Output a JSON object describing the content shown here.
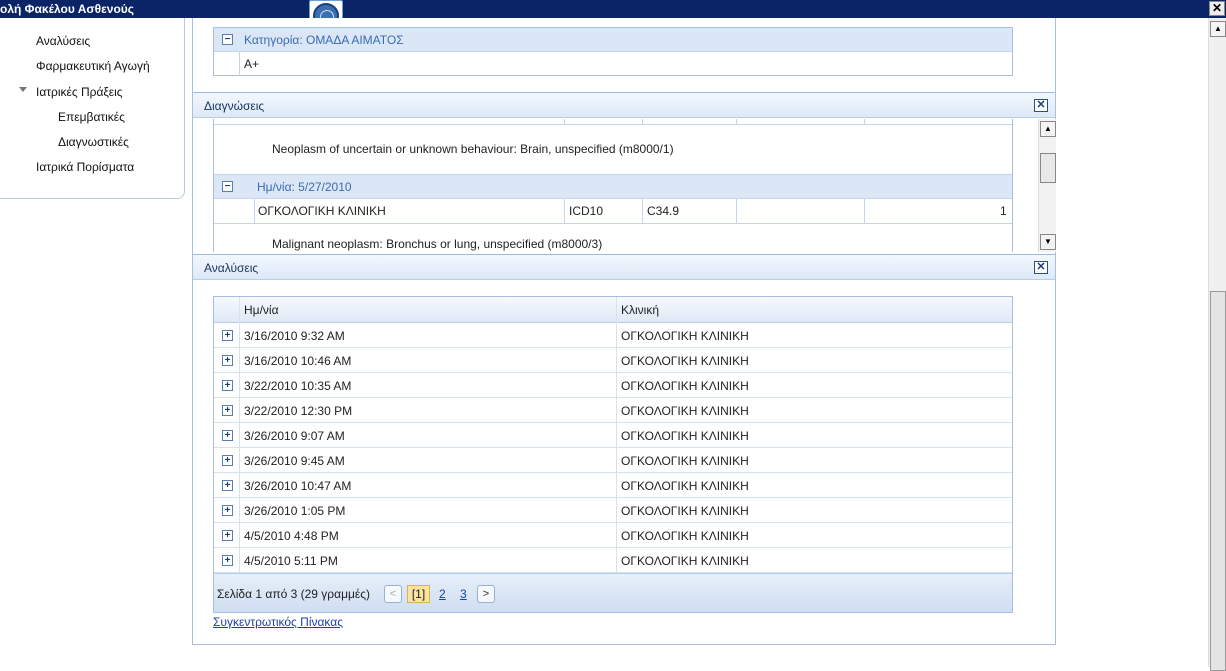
{
  "window": {
    "title": "ολή Φακέλου Ασθενούς",
    "close_glyph": "✕"
  },
  "nav": {
    "items": [
      {
        "label": "Αναλύσεις"
      },
      {
        "label": "Φαρμακευτική Αγωγή"
      },
      {
        "label": "Ιατρικές Πράξεις"
      },
      {
        "label": "Επεμβατικές"
      },
      {
        "label": "Διαγνωστικές"
      },
      {
        "label": "Ιατρικά Πορίσματα"
      }
    ]
  },
  "blood": {
    "category_label": "Κατηγορία: ΟΜΑΔΑ ΑΙΜΑΤΟΣ",
    "value": "A+",
    "toggle": "−"
  },
  "diagnoses_panel": {
    "title": "Διαγνώσεις",
    "close_glyph": "✕",
    "rows": [
      {
        "description": "Neoplasm of uncertain or unknown behaviour: Brain, unspecified (m8000/1)"
      },
      {
        "group": "Ημ/νία: 5/27/2010"
      },
      {
        "clinic": "ΟΓΚΟΛΟΓΙΚΗ ΚΛΙΝΙΚΗ",
        "system": "ICD10",
        "code": "C34.9",
        "extra": "",
        "count": "1"
      },
      {
        "description": "Malignant neoplasm: Bronchus or lung, unspecified (m8000/3)"
      }
    ]
  },
  "analyses_panel": {
    "title": "Αναλύσεις",
    "close_glyph": "✕",
    "columns": {
      "date": "Ημ/νία",
      "clinic": "Κλινική"
    },
    "rows": [
      {
        "date": "3/16/2010 9:32 AM",
        "clinic": "ΟΓΚΟΛΟΓΙΚΗ ΚΛΙΝΙΚΗ"
      },
      {
        "date": "3/16/2010 10:46 AM",
        "clinic": "ΟΓΚΟΛΟΓΙΚΗ ΚΛΙΝΙΚΗ"
      },
      {
        "date": "3/22/2010 10:35 AM",
        "clinic": "ΟΓΚΟΛΟΓΙΚΗ ΚΛΙΝΙΚΗ"
      },
      {
        "date": "3/22/2010 12:30 PM",
        "clinic": "ΟΓΚΟΛΟΓΙΚΗ ΚΛΙΝΙΚΗ"
      },
      {
        "date": "3/26/2010 9:07 AM",
        "clinic": "ΟΓΚΟΛΟΓΙΚΗ ΚΛΙΝΙΚΗ"
      },
      {
        "date": "3/26/2010 9:45 AM",
        "clinic": "ΟΓΚΟΛΟΓΙΚΗ ΚΛΙΝΙΚΗ"
      },
      {
        "date": "3/26/2010 10:47 AM",
        "clinic": "ΟΓΚΟΛΟΓΙΚΗ ΚΛΙΝΙΚΗ"
      },
      {
        "date": "3/26/2010 1:05 PM",
        "clinic": "ΟΓΚΟΛΟΓΙΚΗ ΚΛΙΝΙΚΗ"
      },
      {
        "date": "4/5/2010 4:48 PM",
        "clinic": "ΟΓΚΟΛΟΓΙΚΗ ΚΛΙΝΙΚΗ"
      },
      {
        "date": "4/5/2010 5:11 PM",
        "clinic": "ΟΓΚΟΛΟΓΙΚΗ ΚΛΙΝΙΚΗ"
      }
    ],
    "pager": {
      "info": "Σελίδα 1 από 3 (29 γραμμές)",
      "prev": "<",
      "current": "[1]",
      "page2": "2",
      "page3": "3",
      "next": ">"
    },
    "summary_link": "Συγκεντρωτικός Πίνακας"
  },
  "expand_glyph": "+",
  "scroll": {
    "up": "▲",
    "down": "▼"
  }
}
